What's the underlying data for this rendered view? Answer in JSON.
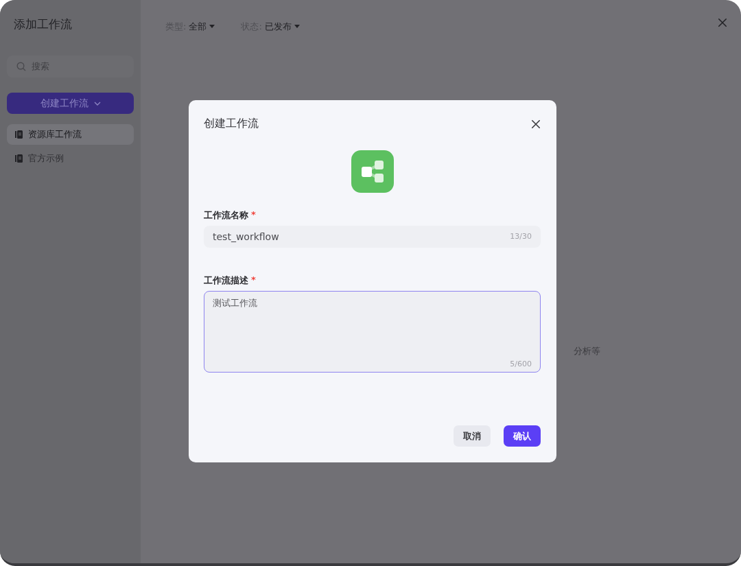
{
  "sidebar": {
    "title": "添加工作流",
    "search": {
      "placeholder": "搜索"
    },
    "create_button": {
      "label": "创建工作流"
    },
    "items": [
      {
        "label": "资源库工作流",
        "selected": true
      },
      {
        "label": "官方示例",
        "selected": false
      }
    ]
  },
  "filters": [
    {
      "label": "类型:",
      "value": "全部"
    },
    {
      "label": "状态:",
      "value": "已发布"
    }
  ],
  "background_text": "分析等",
  "dialog": {
    "title": "创建工作流",
    "fields": [
      {
        "kind": "input",
        "label": "工作流名称",
        "required_mark": "*",
        "value": "test_workflow",
        "count": "13/30",
        "focused": false
      },
      {
        "kind": "textarea",
        "label": "工作流描述",
        "required_mark": "*",
        "value": "测试工作流",
        "count": "5/600",
        "focused": true
      }
    ],
    "buttons": [
      {
        "label": "取消",
        "kind": "secondary"
      },
      {
        "label": "确认",
        "kind": "primary"
      }
    ]
  }
}
